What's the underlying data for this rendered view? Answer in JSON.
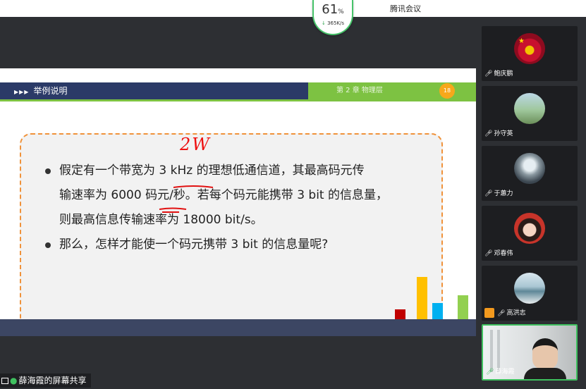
{
  "app": {
    "title": "腾讯会议"
  },
  "network": {
    "quality_percent_value": "61",
    "quality_percent_sign": "%",
    "rate": "365K/s"
  },
  "slide": {
    "section_title": "举例说明",
    "chapter": "第 2 章   物理层",
    "page_number": "18",
    "annotation": "2W",
    "bullets": [
      "假定有一个带宽为 3 kHz 的理想低通信道，其最高码元传输速率为 6000  码元/秒。若每个码元能携带 3 bit 的信息量，则最高信息传输速率为 18000 bit/s。",
      "那么，怎样才能使一个码元携带 3 bit 的信息量呢?"
    ],
    "bullet1_lines": [
      "假定有一个带宽为 3 kHz 的理想低通信道，其最高码元传",
      "输速率为 6000  码元/秒。若每个码元能携带 3 bit 的信息量，",
      "则最高信息传输速率为 18000 bit/s。"
    ]
  },
  "screen_share": {
    "label": "薛海霞的屏幕共享"
  },
  "participants": [
    {
      "name": "鲍庆鹏"
    },
    {
      "name": "孙守英"
    },
    {
      "name": "于蕙力"
    },
    {
      "name": "邓春伟"
    },
    {
      "name": "高洪志"
    },
    {
      "name": "薛海霞"
    }
  ],
  "colors": {
    "header_navy": "#2b3a67",
    "header_green": "#7dc242",
    "page_badge": "#f7a81b",
    "dashed_border": "#f0923a",
    "annotation_red": "#e11111",
    "bar_red": "#c00000",
    "bar_yellow": "#ffc000",
    "bar_blue": "#00b0f0",
    "bar_green": "#92d050"
  },
  "decor_bars": [
    {
      "color": "#c00000",
      "level": 0.28
    },
    {
      "color": "#ffc000",
      "level": 1.0
    },
    {
      "color": "#00b0f0",
      "level": 0.42
    },
    {
      "color": "#92d050",
      "level": 0.6
    }
  ]
}
